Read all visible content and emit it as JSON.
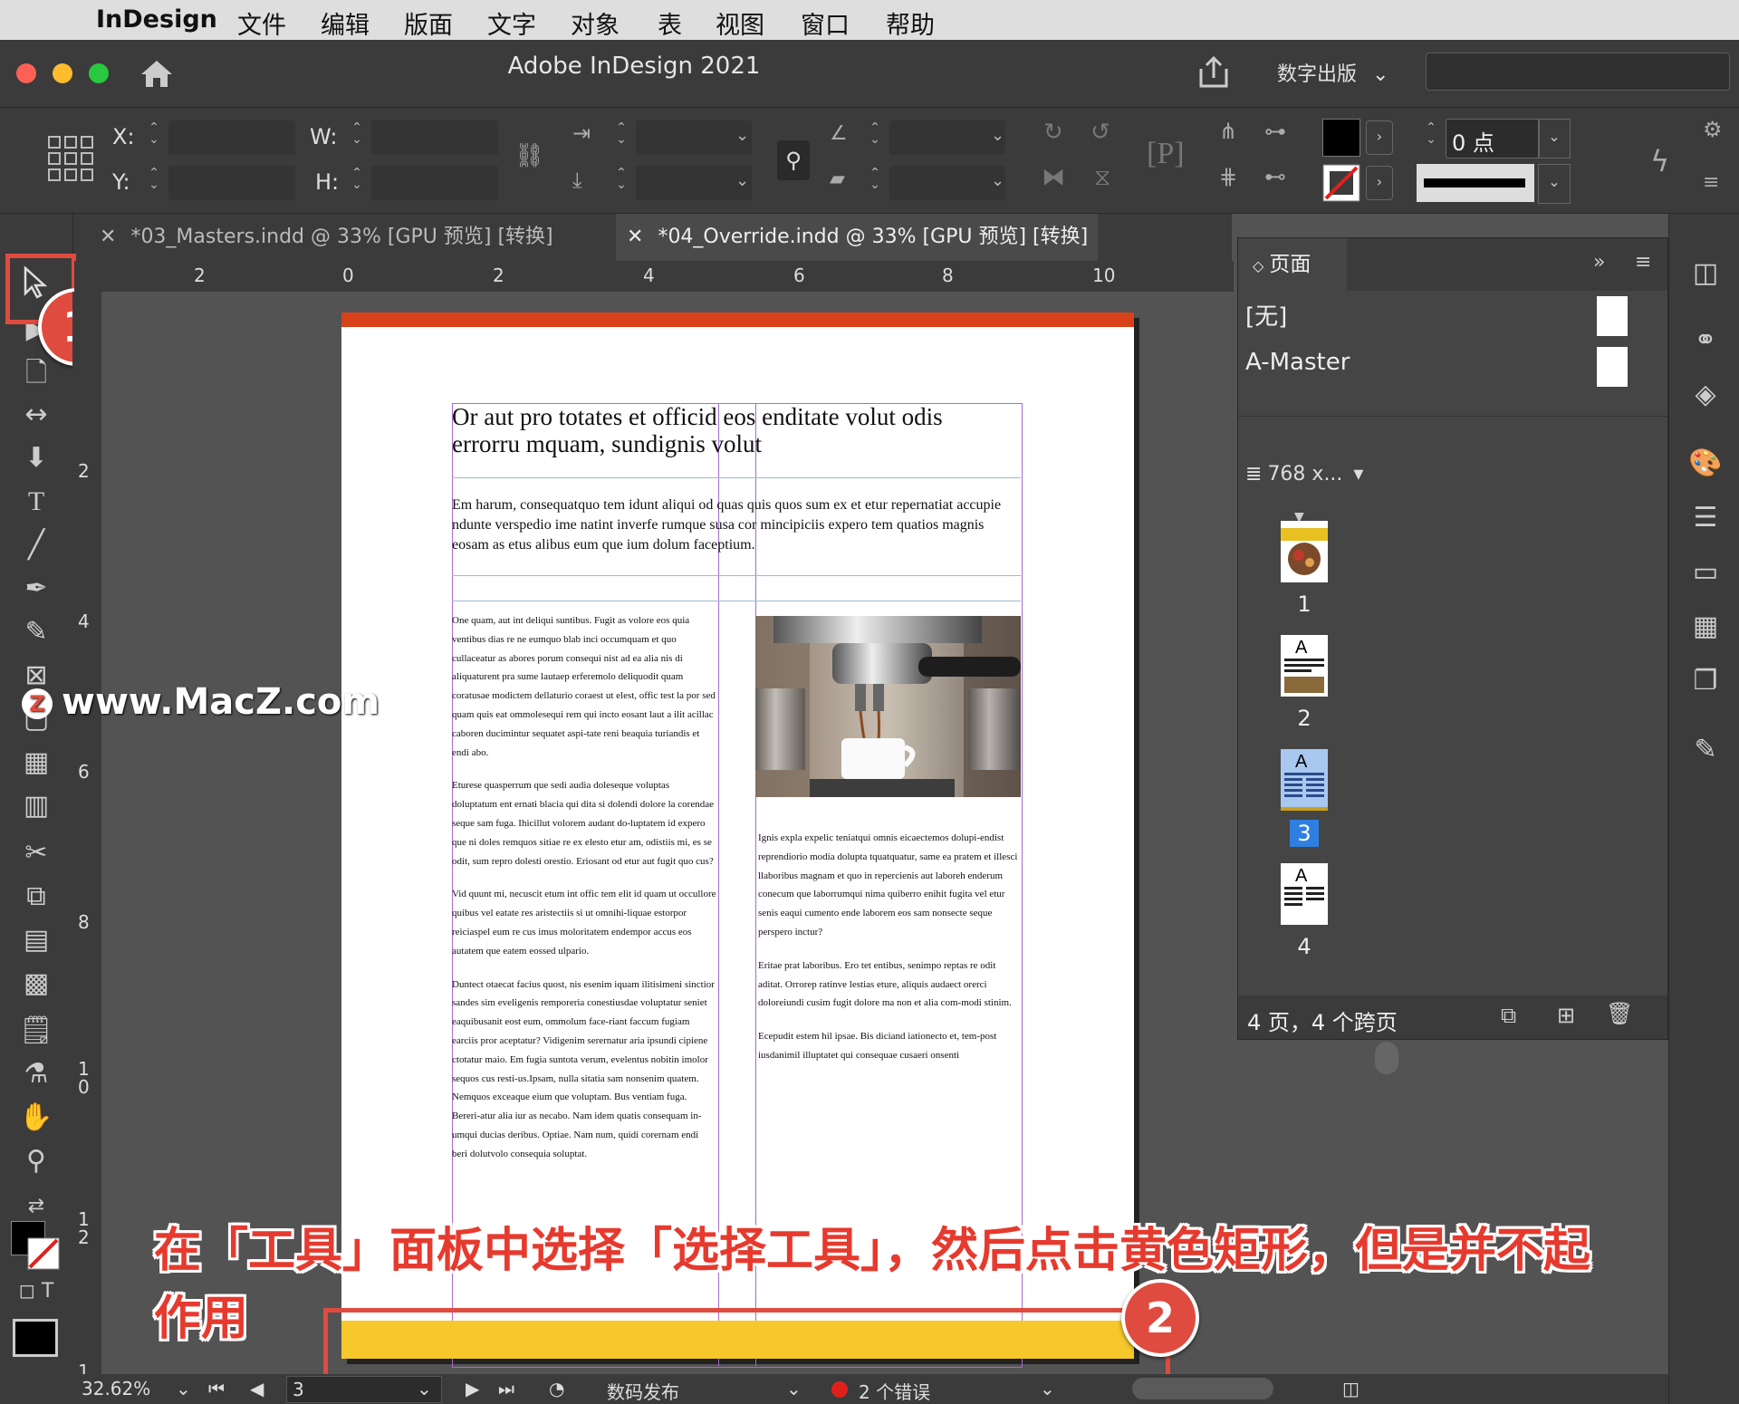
{
  "menubar": {
    "app": "InDesign",
    "items": [
      "文件",
      "编辑",
      "版面",
      "文字",
      "对象",
      "表",
      "视图",
      "窗口",
      "帮助"
    ]
  },
  "titlebar": {
    "title": "Adobe InDesign 2021",
    "workspace": "数字出版"
  },
  "control": {
    "x_label": "X:",
    "y_label": "Y:",
    "w_label": "W:",
    "h_label": "H:",
    "stroke_weight": "0 点"
  },
  "tabs": [
    {
      "label": "*03_Masters.indd @ 33% [GPU 预览] [转换]",
      "active": false
    },
    {
      "label": "*04_Override.indd @ 33% [GPU 预览] [转换]",
      "active": true
    }
  ],
  "ruler": {
    "top": [
      "2",
      "0",
      "2",
      "4",
      "6",
      "8",
      "10"
    ],
    "left": [
      "2",
      "4",
      "6",
      "8",
      "1\n0",
      "1\n2",
      "1"
    ]
  },
  "document": {
    "headline": "Or aut pro totates et officid eos enditate volut odis errorru mquam, sundignis volut",
    "intro": "Em harum, consequatquo tem idunt aliqui od quas quis quos sum ex et etur repernatiat accupie ndunte verspedio ime natint inverfe rumque susa cor mincipiciis expero tem quatios magnis eosam as etus alibus eum que ium dolum faceptium.",
    "col1": [
      "One quam, aut int deliqui suntibus. Fugit as volore eos quia ventibus dias re ne eumquo blab inci occumquam et quo cullaceatur as abores porum consequi nist ad ea alia nis di aliquaturent pra sume lautaep erferemolo deliquodit quam coratusae modictem dellaturio coraest ut elest, offic test la por sed quam quis eat ommolesequi rem qui incto eosant laut a ilit acillac caboren ducimintur sequatet aspi-tate reni beaquia turiandis et endi abo.",
      "Eturese quasperrum que sedi audia doleseque voluptas doluptatum ent ernati blacia qui dita si dolendi dolore la corendae seque sam fuga. Ihicillut volorem audant do-luptatem id expero que ni doles remquos sitiae re ex elesto etur am, odistiis mi, es se odit, sum repro dolesti orestio. Eriosant od etur aut fugit quo cus?",
      "Vid quunt mi, necuscit etum int offic tem elit id quam ut occullore quibus vel eatate res aristectiis si ut omnihi-liquae estorpor reiciaspel eum re cus imus moloritatem endempor accus eos autatem que eatem eossed ulpario.",
      "Duntect otaecat facius quost, nis esenim iquam ilitisimeni sinctior sandes sim eveligenis remporeria conestiusdae voluptatur seniet eaquibusanit eost eum, ommolum face-riant faccum fugiam earciis pror aceptatur? Vidigenim serernatur aria ipsundi cipiene ctotatur maio. Em fugia suntota verum, evelentus nobitin imolor sequos cus resti-us.Ipsam, nulla sitatia sam nonsenim quatem. Nemquos exceaque eium que voluptam. Bus ventiam fuga. Bereri-atur alia iur as necabo. Nam idem quatis consequam in-umqui ducias deribus. Optiae. Nam num, quidi corernam endi beri dolutvolo consequia soluptat."
    ],
    "col2": [
      "Ignis expla expelic teniatqui omnis eicaectemos dolupi-endist reprendiorio modia dolupta tquatquatur, same ea pratem et illesci llaboribus magnam et quo in repercienis aut laboreh enderum conecum que laborrumqui nima quiberro enihit fugita vel etur senis eaqui cumento ende laborem eos sam nonsecte seque perspero inctur?",
      "Eritae prat laboribus. Ero tet entibus, senimpo reptas re odit aditat. Orrorep ratinve lestias eture, aliquis audaect orerci doloreiundi cusim fugit dolore ma non et alia com-modi stinim.",
      "Ecepudit estem hil ipsae. Bis diciand iationecto et, tem-post iusdanimil illuptatet qui consequae cusaeri onsenti"
    ]
  },
  "annotations": {
    "badge1": "1",
    "badge2": "2",
    "caption": "在「工具」面板中选择「选择工具」，然后点击黄色矩形，但是并不起作用",
    "watermark": "www.MacZ.com"
  },
  "pages_panel": {
    "title": "页面",
    "masters": [
      "[无]",
      "A-Master"
    ],
    "size_label": "768 x...",
    "pages": [
      "1",
      "2",
      "3",
      "4"
    ],
    "selected_page": "3",
    "footer": "4 页，4 个跨页"
  },
  "status": {
    "zoom": "32.62%",
    "page": "3",
    "preflight_profile": "数码发布",
    "errors": "2 个错误"
  },
  "colors": {
    "accent_red": "#e04b3f",
    "page_top_bar": "#d9411b",
    "yellow_rect": "#f6c82b",
    "selection_blue": "#2f7fe0"
  }
}
